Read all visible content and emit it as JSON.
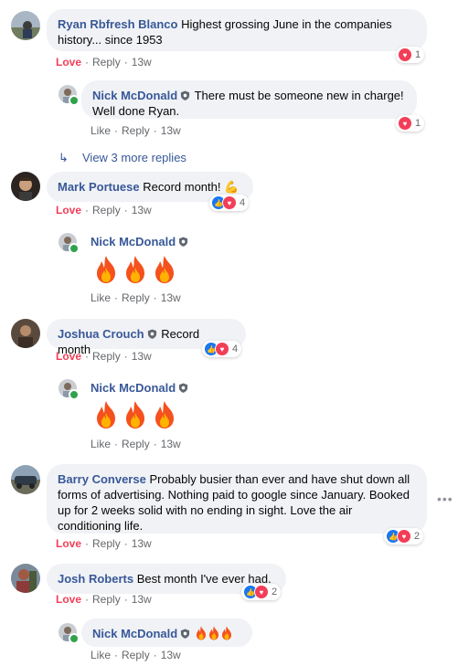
{
  "comments": [
    {
      "author": "Ryan Rbfresh Blanco",
      "text": "Highest grossing June in the companies history... since 1953",
      "actions": {
        "react": "Love",
        "reply": "Reply",
        "time": "13w"
      },
      "reaction_count": "1",
      "replies": [
        {
          "author": "Nick McDonald",
          "text": "There must be someone new in charge! Well done Ryan.",
          "actions": {
            "like": "Like",
            "reply": "Reply",
            "time": "13w"
          },
          "reaction_count": "1"
        }
      ],
      "view_more": "View 3 more replies"
    },
    {
      "author": "Mark Portuese",
      "text": "Record month! 💪",
      "actions": {
        "react": "Love",
        "reply": "Reply",
        "time": "13w"
      },
      "reaction_count": "4",
      "replies": [
        {
          "author": "Nick McDonald",
          "emoji": "🔥🔥🔥",
          "actions": {
            "like": "Like",
            "reply": "Reply",
            "time": "13w"
          }
        }
      ]
    },
    {
      "author": "Joshua Crouch",
      "text": "Record month",
      "actions": {
        "react": "Love",
        "reply": "Reply",
        "time": "13w"
      },
      "reaction_count": "4",
      "replies": [
        {
          "author": "Nick McDonald",
          "emoji": "🔥🔥🔥",
          "actions": {
            "like": "Like",
            "reply": "Reply",
            "time": "13w"
          }
        }
      ]
    },
    {
      "author": "Barry Converse",
      "text": "Probably busier than ever and have shut down all forms of advertising. Nothing paid to google since January. Booked up for 2 weeks solid with no ending in sight. Love the air conditioning life.",
      "actions": {
        "react": "Love",
        "reply": "Reply",
        "time": "13w"
      },
      "reaction_count": "2",
      "more_icon": "more-horizontal-icon"
    },
    {
      "author": "Josh Roberts",
      "text": "Best month I've ever had.",
      "actions": {
        "react": "Love",
        "reply": "Reply",
        "time": "13w"
      },
      "reaction_count": "2",
      "replies": [
        {
          "author": "Nick McDonald",
          "emoji": "🔥🔥🔥",
          "actions": {
            "like": "Like",
            "reply": "Reply",
            "time": "13w"
          }
        }
      ]
    }
  ],
  "colors": {
    "name": "#385898",
    "love": "#f33e58",
    "like": "#1877f2",
    "bubble": "#f0f2f5",
    "meta": "#65676b",
    "online": "#31a24c"
  }
}
